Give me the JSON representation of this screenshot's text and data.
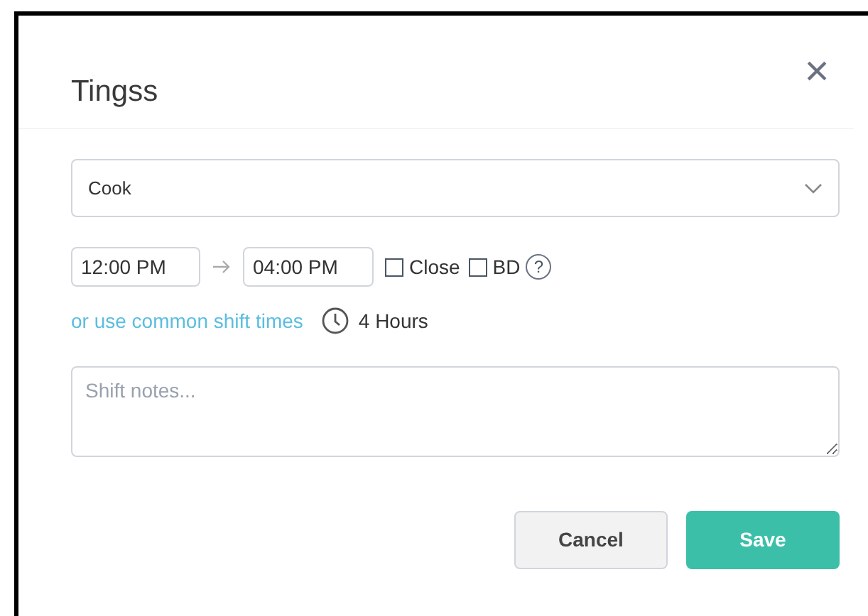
{
  "dialog": {
    "title": "Tingss",
    "close": "×"
  },
  "role_select": {
    "value": "Cook"
  },
  "start_time": {
    "value": "12:00 PM"
  },
  "end_time": {
    "value": "04:00 PM"
  },
  "options": [
    {
      "label": "Close",
      "checked": false
    },
    {
      "label": "BD",
      "checked": false
    }
  ],
  "help": "?",
  "common_link": "or use common shift times",
  "duration": "4 Hours",
  "notes": {
    "placeholder": "Shift notes..."
  },
  "buttons": [
    {
      "kind": "secondary",
      "label": "Cancel"
    },
    {
      "kind": "primary",
      "label": "Save"
    }
  ]
}
